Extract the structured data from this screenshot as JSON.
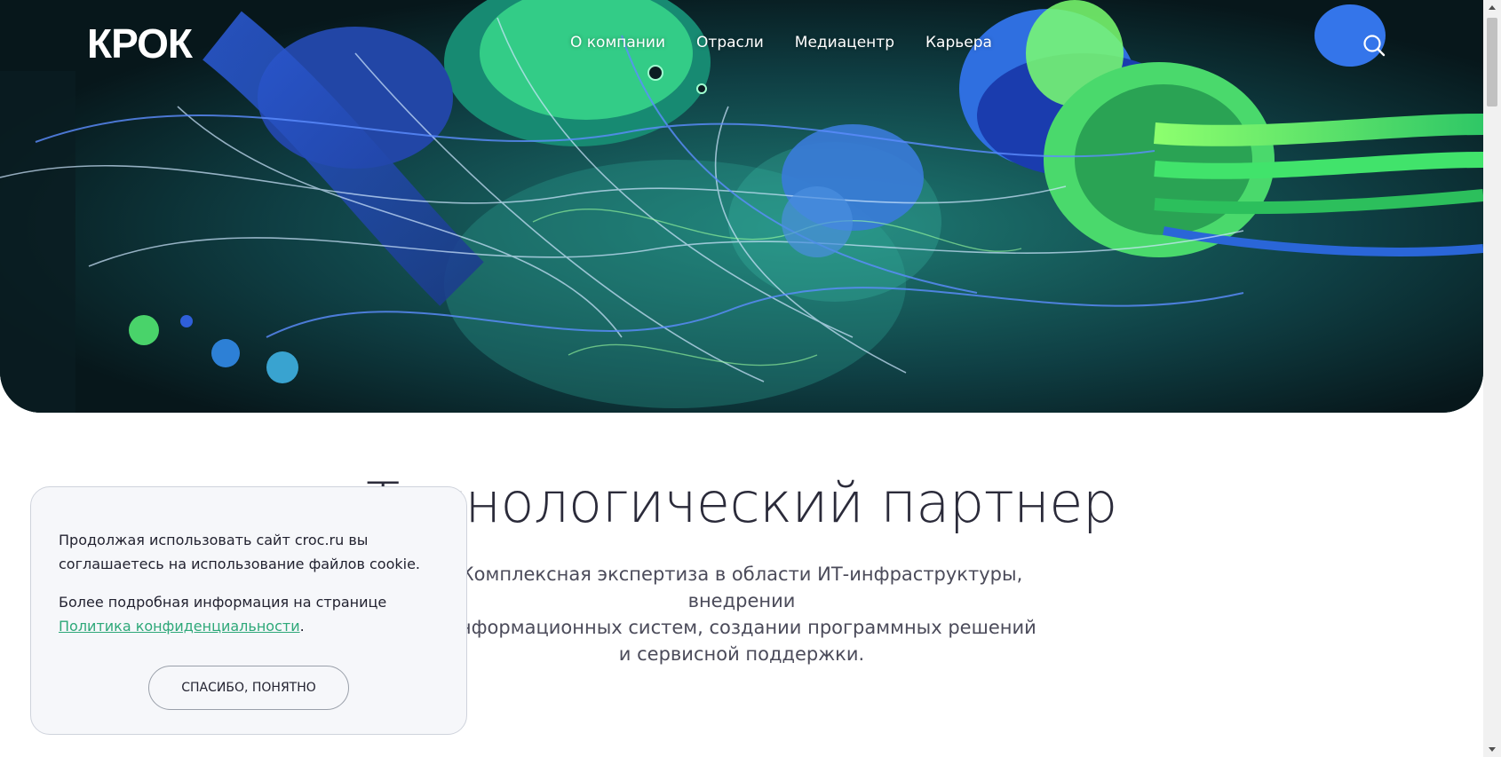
{
  "header": {
    "logo": "КРОК",
    "nav": [
      {
        "label": "О компании"
      },
      {
        "label": "Отрасли"
      },
      {
        "label": "Медиацентр"
      },
      {
        "label": "Карьера"
      }
    ],
    "search_icon": "search-icon"
  },
  "hero": {
    "image": "abstract-cables-artwork",
    "colors": {
      "dark": "#0a2a2e",
      "green": "#7dff6a",
      "blue": "#2f5fd9",
      "teal": "#1f8b8a"
    }
  },
  "main": {
    "headline_hidden": "Те",
    "headline_visible": "хнологический партнер",
    "subtext": {
      "line1_hidden": "Компл",
      "line1": "ексная экспертиза в области ИТ-инфраструктуры, внедрении",
      "line2_hidden": "и",
      "line2": "нформационных систем, создании программных решений",
      "line3": "и сервисной поддержки."
    }
  },
  "cookie": {
    "text1": "Продолжая использовать сайт croc.ru вы соглашаетесь на использование файлов cookie.",
    "text2_prefix": "Более подробная информация на странице ",
    "link": "Политика конфиденциальности",
    "text2_suffix": ".",
    "button": "СПАСИБО, ПОНЯТНО"
  }
}
